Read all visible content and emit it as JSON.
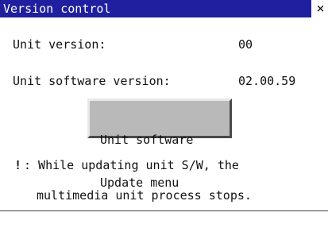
{
  "window": {
    "title": "Version control",
    "close_glyph": "×"
  },
  "info": {
    "unit_version_label": "Unit version:",
    "unit_version_value": "00",
    "unit_software_version_label": "Unit software version:",
    "unit_software_version_value": "02.00.59"
  },
  "update_button": {
    "line1": "Unit software",
    "line2": "Update menu"
  },
  "note": {
    "mark": "!",
    "line1": ": While updating unit S/W, the",
    "line2": "multimedia unit process stops."
  },
  "colors": {
    "title_bar": "#1f1fa0",
    "button_face": "#b9b9b9"
  }
}
